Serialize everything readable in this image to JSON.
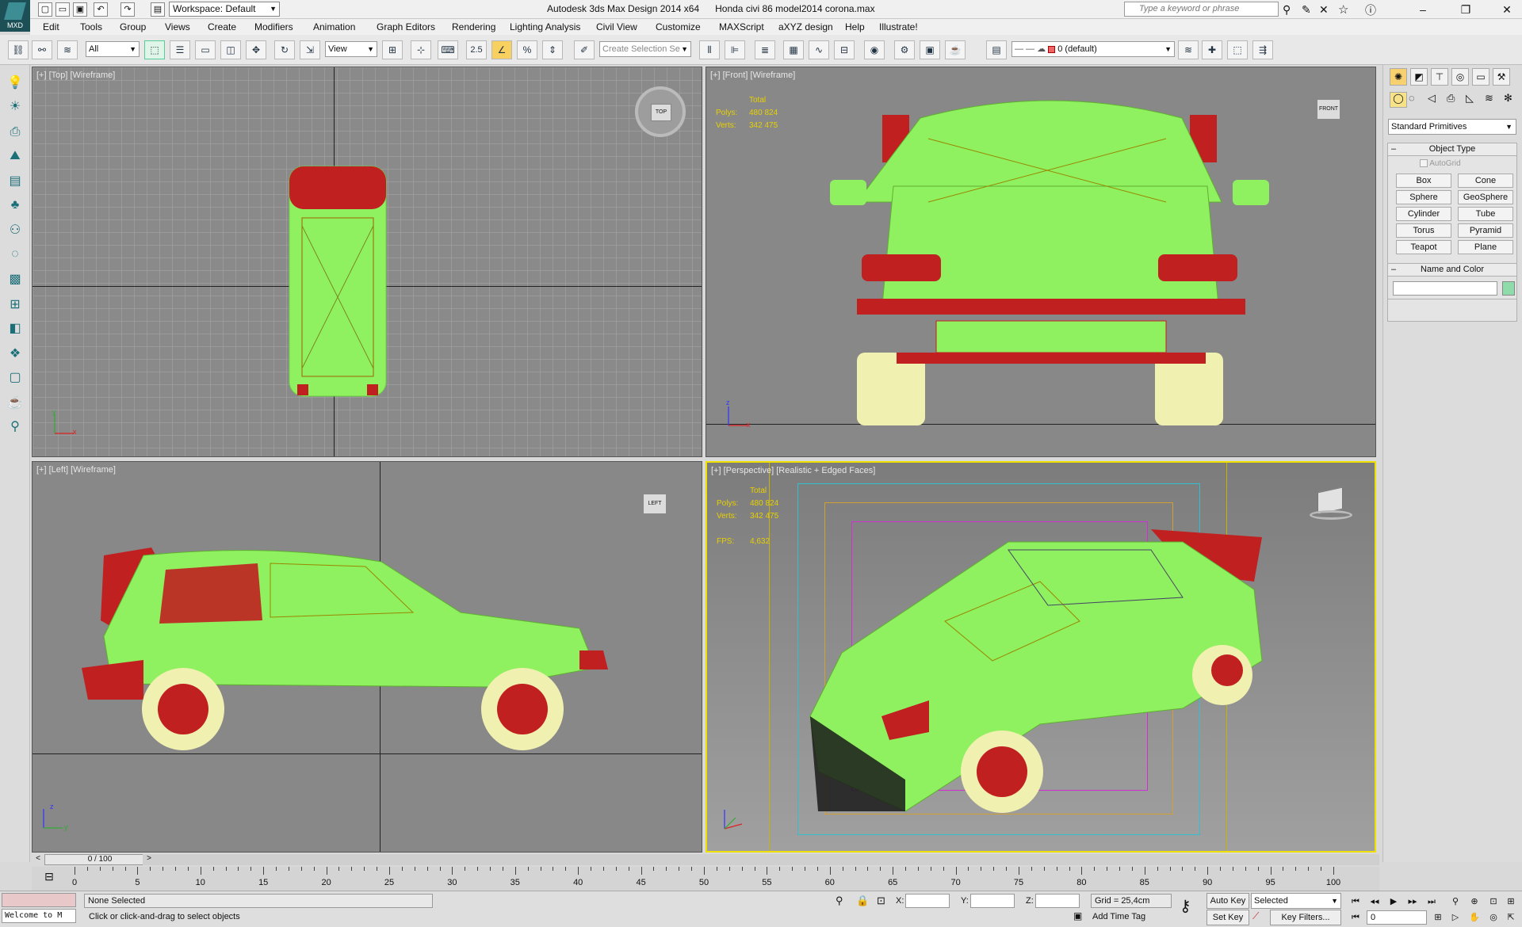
{
  "titlebar": {
    "logo_text": "MXD",
    "workspace": "Workspace: Default",
    "title": "Autodesk 3ds Max Design 2014 x64      Honda civi 86 model2014 corona.max",
    "search_placeholder": "Type a keyword or phrase"
  },
  "menus": [
    "Edit",
    "Tools",
    "Group",
    "Views",
    "Create",
    "Modifiers",
    "Animation",
    "Graph Editors",
    "Rendering",
    "Lighting Analysis",
    "Civil View",
    "Customize",
    "MAXScript",
    "aXYZ design",
    "Help",
    "Illustrate!"
  ],
  "toolbar": {
    "filter": "All",
    "refcoord": "View",
    "snap_value": "2.5",
    "selection_set": "Create Selection Se",
    "layer": "0 (default)"
  },
  "viewports": {
    "top": {
      "label": "[+] [Top] [Wireframe]",
      "cube": "TOP"
    },
    "front": {
      "label": "[+] [Front] [Wireframe]",
      "cube": "FRONT",
      "stats": {
        "total_label": "Total",
        "polys_label": "Polys:",
        "polys": "480 824",
        "verts_label": "Verts:",
        "verts": "342 475"
      }
    },
    "left": {
      "label": "[+] [Left] [Wireframe]",
      "cube": "LEFT"
    },
    "persp": {
      "label": "[+] [Perspective] [Realistic + Edged Faces]",
      "stats": {
        "total_label": "Total",
        "polys_label": "Polys:",
        "polys": "480 824",
        "verts_label": "Verts:",
        "verts": "342 475",
        "fps_label": "FPS:",
        "fps": "4,632"
      }
    }
  },
  "axes": {
    "x": "x",
    "y": "y",
    "z": "z"
  },
  "command_panel": {
    "dropdown": "Standard Primitives",
    "object_type_title": "Object Type",
    "autogrid": "AutoGrid",
    "primitives": [
      "Box",
      "Cone",
      "Sphere",
      "GeoSphere",
      "Cylinder",
      "Tube",
      "Torus",
      "Pyramid",
      "Teapot",
      "Plane"
    ],
    "name_color_title": "Name and Color",
    "swatch_color": "#8fdcaa"
  },
  "timeline": {
    "frame_display": "0 / 100",
    "ticks": [
      "0",
      "5",
      "10",
      "15",
      "20",
      "25",
      "30",
      "35",
      "40",
      "45",
      "50",
      "55",
      "60",
      "65",
      "70",
      "75",
      "80",
      "85",
      "90",
      "95",
      "100"
    ]
  },
  "status": {
    "maxscript_listener": "Welcome to M",
    "selection": "None Selected",
    "prompt": "Click or click-and-drag to select objects",
    "x_label": "X:",
    "y_label": "Y:",
    "z_label": "Z:",
    "grid": "Grid = 25,4cm",
    "add_time_tag": "Add Time Tag",
    "auto_key": "Auto Key",
    "set_key": "Set Key",
    "key_mode": "Selected",
    "key_filters": "Key Filters...",
    "current_frame": "0"
  },
  "colors": {
    "wire_green": "#8ff060",
    "wire_red": "#c02020",
    "tire": "#f0f0b0",
    "active_border": "#f0e000"
  }
}
